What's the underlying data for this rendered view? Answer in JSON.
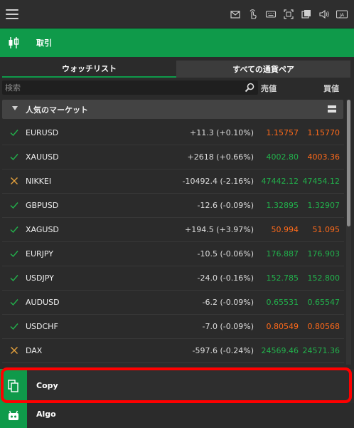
{
  "topbar": {
    "icons": [
      "mail-icon",
      "touch-icon",
      "keyboard-icon",
      "fullscreen-icon",
      "layers-icon",
      "sound-icon",
      "language-icon"
    ],
    "language": "JA"
  },
  "trade": {
    "title": "取引"
  },
  "tabs": [
    {
      "label": "ウォッチリスト",
      "active": true
    },
    {
      "label": "すべての通貨ペア",
      "active": false
    }
  ],
  "search": {
    "placeholder": "検索",
    "value": ""
  },
  "columns": {
    "bid": "売値",
    "ask": "買値"
  },
  "group": {
    "title": "人気のマーケット"
  },
  "instruments": [
    {
      "symbol": "EURUSD",
      "state": "check",
      "change": "+11.3 (+0.10%)",
      "bid": "1.15757",
      "ask": "1.15770",
      "bid_dir": "down",
      "ask_dir": "down"
    },
    {
      "symbol": "XAUUSD",
      "state": "check",
      "change": "+2618 (+0.66%)",
      "bid": "4002.80",
      "ask": "4003.36",
      "bid_dir": "up",
      "ask_dir": "down"
    },
    {
      "symbol": "NIKKEI",
      "state": "cross",
      "change": "-10492.4 (-2.16%)",
      "bid": "47442.12",
      "ask": "47454.12",
      "bid_dir": "up",
      "ask_dir": "up"
    },
    {
      "symbol": "GBPUSD",
      "state": "check",
      "change": "-12.6 (-0.09%)",
      "bid": "1.32895",
      "ask": "1.32907",
      "bid_dir": "up",
      "ask_dir": "up"
    },
    {
      "symbol": "XAGUSD",
      "state": "check",
      "change": "+194.5 (+3.97%)",
      "bid": "50.994",
      "ask": "51.095",
      "bid_dir": "down",
      "ask_dir": "down"
    },
    {
      "symbol": "EURJPY",
      "state": "check",
      "change": "-10.5 (-0.06%)",
      "bid": "176.887",
      "ask": "176.903",
      "bid_dir": "up",
      "ask_dir": "up"
    },
    {
      "symbol": "USDJPY",
      "state": "check",
      "change": "-24.0 (-0.16%)",
      "bid": "152.785",
      "ask": "152.800",
      "bid_dir": "up",
      "ask_dir": "up"
    },
    {
      "symbol": "AUDUSD",
      "state": "check",
      "change": "-6.2 (-0.09%)",
      "bid": "0.65531",
      "ask": "0.65547",
      "bid_dir": "up",
      "ask_dir": "up"
    },
    {
      "symbol": "USDCHF",
      "state": "check",
      "change": "-7.0 (-0.09%)",
      "bid": "0.80549",
      "ask": "0.80568",
      "bid_dir": "down",
      "ask_dir": "down"
    },
    {
      "symbol": "DAX",
      "state": "cross",
      "change": "-597.6 (-0.24%)",
      "bid": "24569.46",
      "ask": "24571.36",
      "bid_dir": "up",
      "ask_dir": "up"
    }
  ],
  "bottom": {
    "copy_label": "Copy",
    "algo_label": "Algo"
  },
  "colors": {
    "accent": "#0f9a4a",
    "up": "#22b24c",
    "down": "#ff6a1a",
    "cross": "#e6a23c",
    "highlight": "#ff0000"
  }
}
